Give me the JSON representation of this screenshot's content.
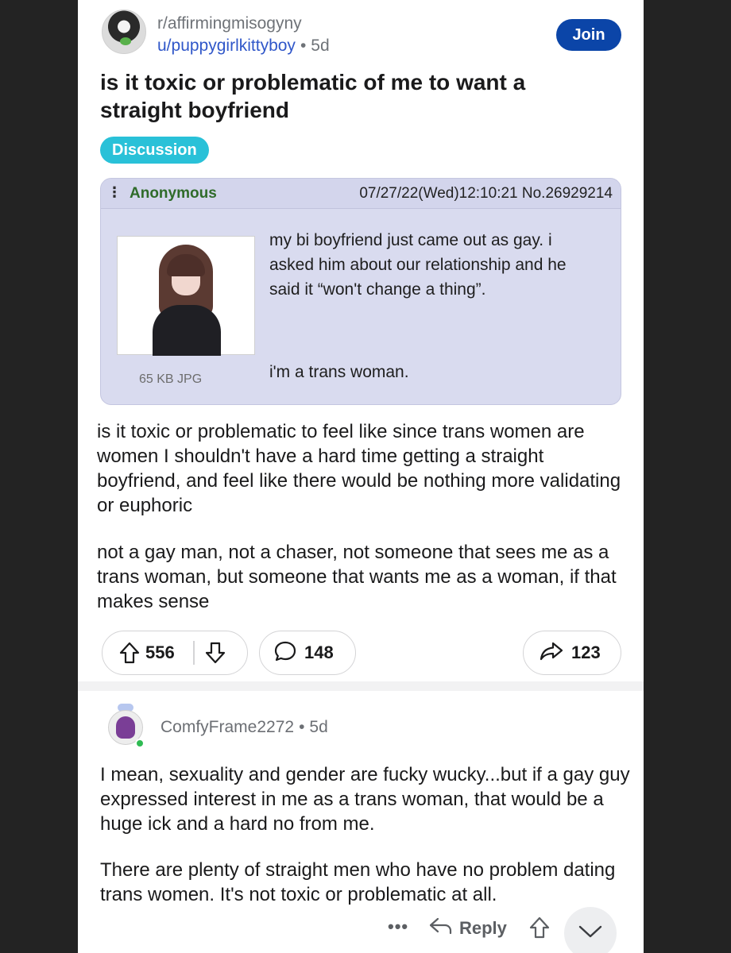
{
  "post": {
    "subreddit": "r/affirmingmisogyny",
    "username": "u/puppygirlkittyboy",
    "separator": "•",
    "age": "5d",
    "join_label": "Join",
    "title": "is it toxic or problematic of me to want a straight boyfriend",
    "flair": "Discussion",
    "embedded": {
      "name": "Anonymous",
      "date": "07/27/22(Wed)12:10:21 No.26929214",
      "text": "my bi boyfriend just came out as gay. i asked him about our relationship and he said it “won't change a thing”.",
      "text2": "i'm a trans woman.",
      "file_label": "65 KB JPG"
    },
    "body": [
      "is it toxic or problematic to feel like since trans women are women I shouldn't have a hard time getting a straight boyfriend, and feel like there would be nothing more validating or euphoric",
      "not a gay man, not a chaser, not someone that sees me as a trans woman, but someone that wants me as a woman, if that makes sense"
    ],
    "upvotes": "556",
    "comments": "148",
    "shares": "123"
  },
  "comment": {
    "author": "ComfyFrame2272",
    "separator": "•",
    "age": "5d",
    "body": [
      "I mean, sexuality and gender are fucky wucky...but if a gay guy expressed interest in me as a trans woman, that would be a huge ick and a hard no from me.",
      "There are plenty of straight men who have no problem dating trans women. It's not toxic or problematic at all."
    ],
    "more_label": "•••",
    "reply_label": "Reply"
  },
  "icons": {
    "upvote": "upvote-arrow-icon",
    "downvote": "downvote-arrow-icon",
    "comment": "speech-bubble-icon",
    "share": "share-arrow-icon",
    "reply": "reply-arrow-icon",
    "collapse": "chevron-down-icon"
  },
  "colors": {
    "join_button": "#0b45a8",
    "flair": "#29c1d8",
    "username": "#3057c9",
    "embedded_bg": "#d9dbef",
    "embedded_name": "#2f6b2a",
    "online": "#2fbb53"
  }
}
